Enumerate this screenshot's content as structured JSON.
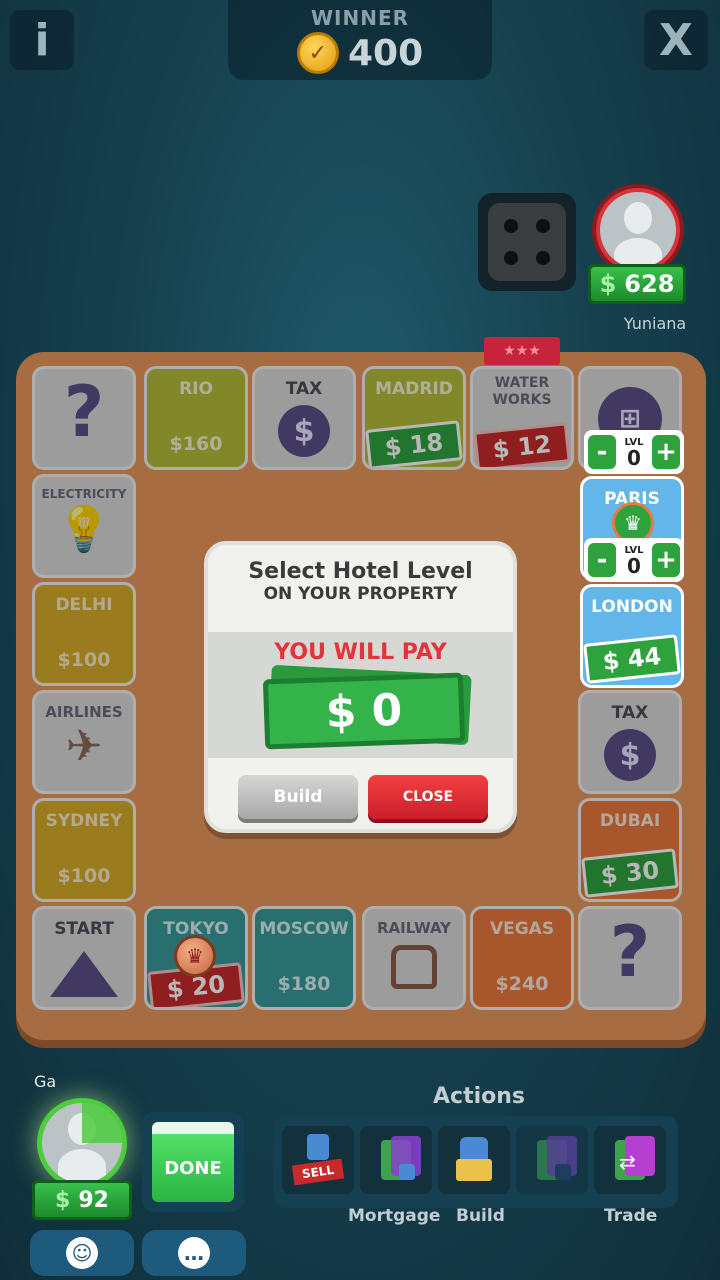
{
  "top": {
    "info_label": "i",
    "close_label": "X",
    "winner_label": "WINNER",
    "winner_amount": "400",
    "coin_icon": "coin-icon"
  },
  "opponent": {
    "name": "Yuniana",
    "money_symbol": "$",
    "money": "628",
    "dice_value": 4
  },
  "board": {
    "tiles": {
      "top_question": "?",
      "rio": {
        "name": "RIO",
        "price": "$160"
      },
      "tax_top": {
        "name": "TAX",
        "icon": "$"
      },
      "madrid": {
        "name": "MADRID",
        "ticket": "$ 18"
      },
      "water_works": {
        "name": "WATER WORKS",
        "ticket": "$ 12",
        "flag": "★★★"
      },
      "electricity": {
        "name": "ELECTRICITY"
      },
      "delhi": {
        "name": "DELHI",
        "price": "$100"
      },
      "airlines": {
        "name": "AIRLINES"
      },
      "sydney": {
        "name": "SYDNEY",
        "price": "$100"
      },
      "start": {
        "name": "START"
      },
      "tokyo": {
        "name": "TOKYO",
        "ticket": "$ 20"
      },
      "moscow": {
        "name": "MOSCOW",
        "price": "$180"
      },
      "railway": {
        "name": "RAILWAY"
      },
      "vegas": {
        "name": "VEGAS",
        "price": "$240"
      },
      "bottom_question": "?",
      "paris": {
        "name": "PARIS"
      },
      "london": {
        "name": "LONDON",
        "ticket": "$ 44"
      },
      "tax_right": {
        "name": "TAX",
        "icon": "$"
      },
      "dubai": {
        "name": "DUBAI",
        "ticket": "$ 30"
      }
    },
    "level_controls": [
      {
        "minus": "-",
        "label": "LVL",
        "value": "0",
        "plus": "+"
      },
      {
        "minus": "-",
        "label": "LVL",
        "value": "0",
        "plus": "+"
      }
    ]
  },
  "dialog": {
    "title": "Select Hotel Level",
    "subtitle": "ON YOUR PROPERTY",
    "pay_label": "YOU WILL PAY",
    "amount": "$ 0",
    "build_label": "Build",
    "close_label": "CLOSE"
  },
  "player": {
    "name": "Ga",
    "money_symbol": "$",
    "money": "92",
    "done_label": "DONE",
    "timer_fraction_remaining": 0.88
  },
  "actions": {
    "title": "Actions",
    "sell_label": "SELL",
    "mortgage_label": "Mortgage",
    "build_label": "Build",
    "trade_label": "Trade"
  }
}
